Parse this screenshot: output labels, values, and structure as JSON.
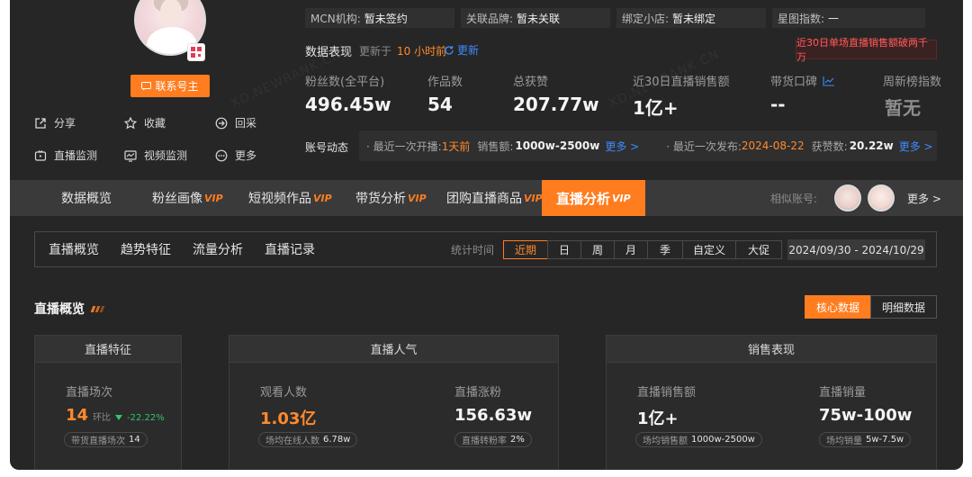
{
  "profile": {
    "contact_label": "联系号主",
    "actions": [
      "分享",
      "收藏",
      "回采",
      "直播监测",
      "视频监测",
      "更多"
    ]
  },
  "meta": [
    {
      "label": "MCN机构:",
      "value": "暂未签约"
    },
    {
      "label": "关联品牌:",
      "value": "暂未关联"
    },
    {
      "label": "绑定小店:",
      "value": "暂未绑定"
    },
    {
      "label": "星图指数:",
      "value": "—"
    }
  ],
  "data_header": {
    "title": "数据表现",
    "updated_prefix": "更新于",
    "updated_value": "10 小时前",
    "refresh_label": "更新",
    "alert": "近30日单场直播销售额破两千万"
  },
  "stats": [
    {
      "label": "粉丝数(全平台)",
      "value": "496.45w"
    },
    {
      "label": "作品数",
      "value": "54"
    },
    {
      "label": "总获赞",
      "value": "207.77w"
    },
    {
      "label": "近30日直播销售额",
      "value": "1亿+"
    },
    {
      "label": "带货口碑",
      "value": "--"
    },
    {
      "label": "周新榜指数",
      "value": "暂无"
    }
  ],
  "dynamic": {
    "title": "账号动态",
    "live_prefix": "· 最近一次开播:",
    "live_value": "1天前",
    "sales_label": "销售额:",
    "sales_value": "1000w-2500w",
    "more1": "更多 >",
    "post_prefix": "· 最近一次发布:",
    "post_value": "2024-08-22",
    "likes_label": "获赞数:",
    "likes_value": "20.22w",
    "more2": "更多 >"
  },
  "nav": {
    "items": [
      {
        "label": "数据概览",
        "vip": ""
      },
      {
        "label": "粉丝画像",
        "vip": "VIP"
      },
      {
        "label": "短视频作品",
        "vip": "VIP"
      },
      {
        "label": "带货分析",
        "vip": "VIP"
      },
      {
        "label": "团购直播商品",
        "vip": "VIP"
      },
      {
        "label": "直播分析",
        "vip": "VIP"
      }
    ],
    "similar_label": "相似账号:",
    "more": "更多 >"
  },
  "subnav": {
    "items": [
      "直播概览",
      "趋势特征",
      "流量分析",
      "直播记录"
    ],
    "time_label": "统计时间",
    "segments": [
      "近期",
      "日",
      "周",
      "月",
      "季",
      "自定义",
      "大促"
    ],
    "date_range": "2024/09/30 - 2024/10/29"
  },
  "overview": {
    "title": "直播概览",
    "toggle": [
      "核心数据",
      "明细数据"
    ]
  },
  "cards": {
    "feature": {
      "head": "直播特征",
      "label": "直播场次",
      "value": "14",
      "ratio_label": "环比",
      "ratio_value": "-22.22%",
      "pill_label": "带货直播场次",
      "pill_value": "14"
    },
    "popularity": {
      "head": "直播人气",
      "k1_label": "观看人数",
      "k1_value": "1.03亿",
      "k1_pill_label": "场均在线人数",
      "k1_pill_value": "6.78w",
      "k2_label": "直播涨粉",
      "k2_value": "156.63w",
      "k2_pill_label": "直播转粉率",
      "k2_pill_value": "2%"
    },
    "sales": {
      "head": "销售表现",
      "k1_label": "直播销售额",
      "k1_value": "1亿+",
      "k1_pill_label": "场均销售额",
      "k1_pill_value": "1000w-2500w",
      "k2_label": "直播销量",
      "k2_value": "75w-100w",
      "k2_pill_label": "场均销量",
      "k2_pill_value": "5w-7.5w"
    }
  },
  "watermark": "XD.NEWRANK.CN",
  "colors": {
    "accent": "#ff7d1f",
    "background": "#262626",
    "link": "#3d8bff",
    "negative": "#33c46b"
  }
}
